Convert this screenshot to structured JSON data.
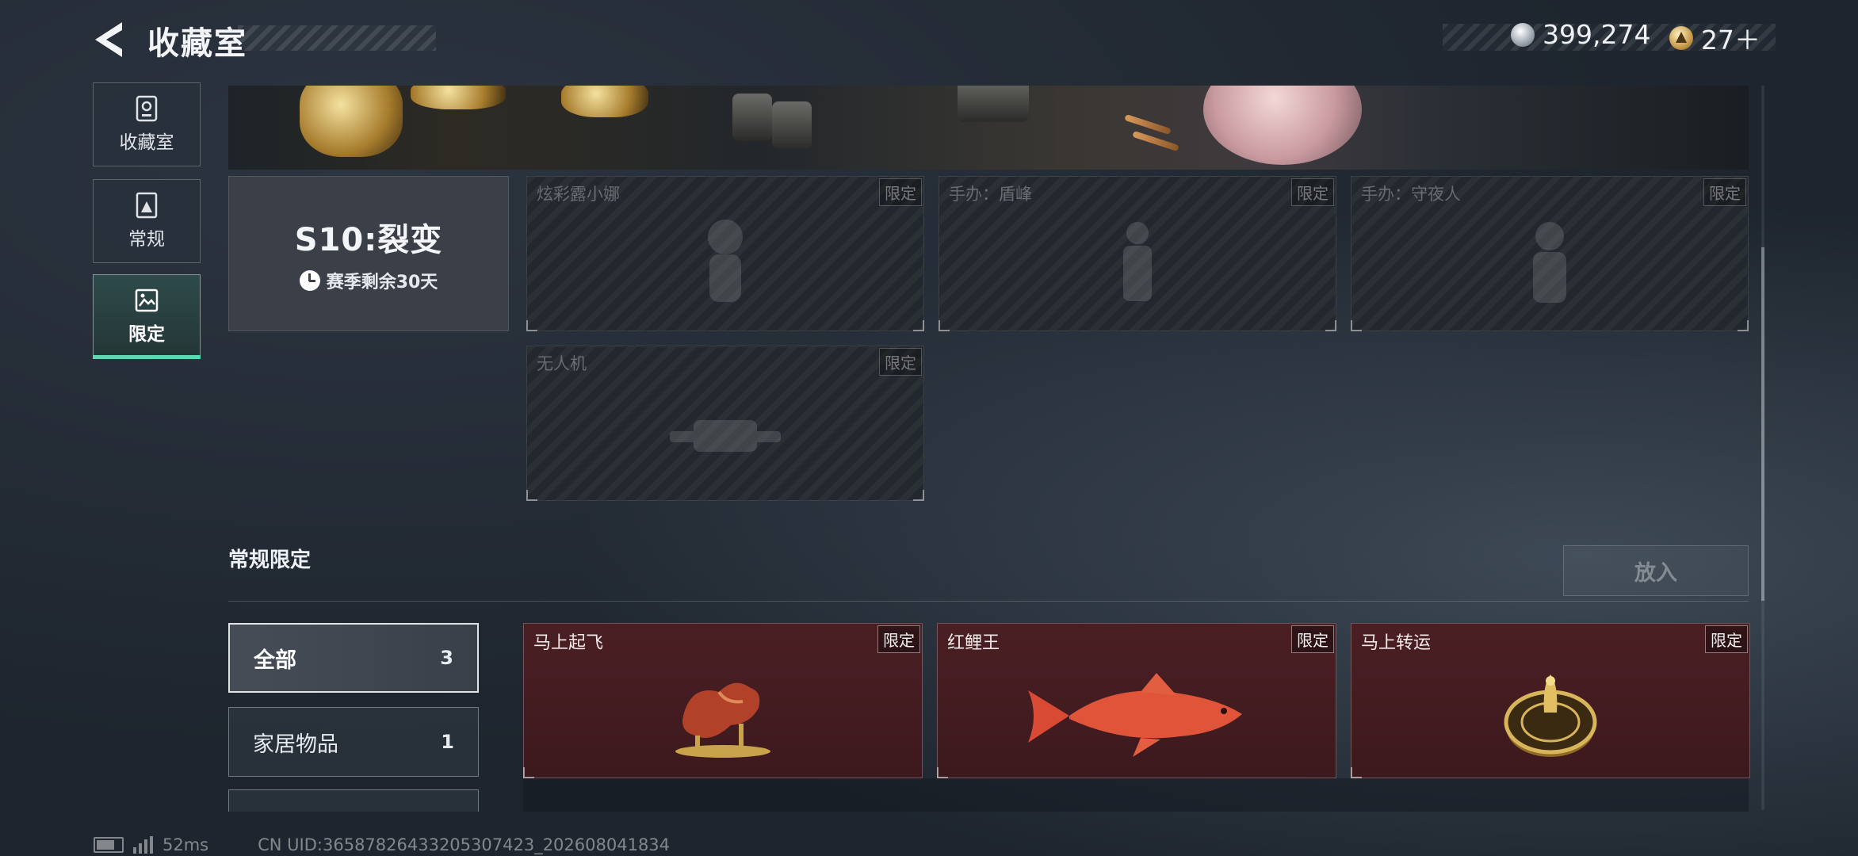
{
  "header": {
    "title": "收藏室",
    "back_icon": "back-arrow-icon",
    "currency": [
      {
        "icon": "silver-coin-icon",
        "value": "399,274",
        "color": "#9aa3ad"
      },
      {
        "icon": "gold-coin-icon",
        "value": "27＋",
        "color": "#c79b4a"
      }
    ]
  },
  "sidebar": {
    "items": [
      {
        "label": "收藏室",
        "icon": "trophy-icon",
        "selected": false
      },
      {
        "label": "常规",
        "icon": "image-frame-icon",
        "selected": false
      },
      {
        "label": "限定",
        "icon": "landscape-frame-icon",
        "selected": true
      }
    ],
    "accent": "#5fd6b0"
  },
  "season": {
    "name": "S10:裂变",
    "remaining": "赛季剩余30天"
  },
  "season_slots": [
    {
      "name": "炫彩露小娜",
      "tag": "限定"
    },
    {
      "name": "手办：盾峰",
      "tag": "限定"
    },
    {
      "name": "手办：守夜人",
      "tag": "限定"
    },
    {
      "name": "无人机",
      "tag": "限定"
    }
  ],
  "regular_section": {
    "title": "常规限定",
    "place_button": "放入",
    "filters": [
      {
        "label": "全部",
        "count": "3",
        "selected": true
      },
      {
        "label": "家居物品",
        "count": "1",
        "selected": false
      }
    ],
    "items": [
      {
        "name": "马上起飞",
        "tag": "限定",
        "art": "golden-horse-statue"
      },
      {
        "name": "红鲤王",
        "tag": "限定",
        "art": "red-carp"
      },
      {
        "name": "马上转运",
        "tag": "限定",
        "art": "golden-fortune-wheel"
      }
    ],
    "card_color": "#4a1f24"
  },
  "footer": {
    "ping": "52ms",
    "uid": "CN UID:3658782643320530​7423_202608041834"
  }
}
